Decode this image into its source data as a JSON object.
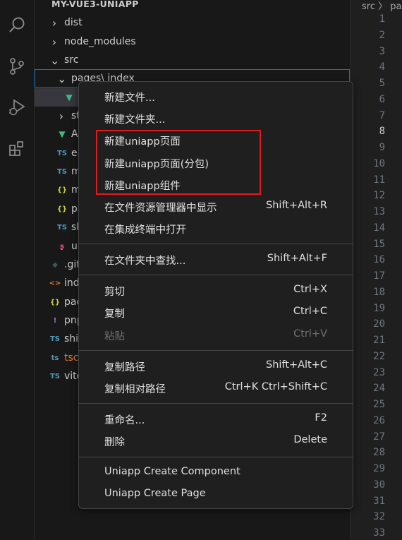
{
  "explorer": {
    "title": "MY-VUE3-UNIAPP",
    "items": [
      {
        "label": "dist",
        "icon": "chevron-right-icon",
        "chev": "›"
      },
      {
        "label": "node_modules",
        "icon": "chevron-right-icon",
        "chev": "›"
      },
      {
        "label": "src",
        "icon": "chevron-down-icon",
        "chev": "⌄"
      },
      {
        "label": "pages\\ index",
        "icon": "chevron-down-icon",
        "chev": "⌄"
      },
      {
        "label": "",
        "icon": "vue-icon",
        "glyph": "▼",
        "color": "#41b883"
      },
      {
        "label": "st",
        "icon": "chevron-right-icon",
        "chev": "›"
      },
      {
        "label": "A",
        "icon": "vue-icon",
        "glyph": "▼",
        "color": "#41b883"
      },
      {
        "label": "er",
        "icon": "typescript-icon",
        "glyph": "TS",
        "color": "#519aba"
      },
      {
        "label": "m",
        "icon": "typescript-icon",
        "glyph": "TS",
        "color": "#519aba"
      },
      {
        "label": "m",
        "icon": "json-icon",
        "glyph": "{}",
        "color": "#cbcb41"
      },
      {
        "label": "pa",
        "icon": "json-icon",
        "glyph": "{}",
        "color": "#cbcb41"
      },
      {
        "label": "sh",
        "icon": "typescript-icon",
        "glyph": "TS",
        "color": "#519aba"
      },
      {
        "label": "ur",
        "icon": "sass-icon",
        "glyph": "ʂ",
        "color": "#f55385"
      },
      {
        "label": ".git",
        "icon": "git-icon",
        "glyph": "◆",
        "color": "#41535b"
      },
      {
        "label": "ind",
        "icon": "html-icon",
        "glyph": "<>",
        "color": "#e37933"
      },
      {
        "label": "pac",
        "icon": "json-icon",
        "glyph": "{}",
        "color": "#cbcb41"
      },
      {
        "label": "pnp",
        "icon": "yaml-icon",
        "glyph": "!",
        "color": "#a074c4"
      },
      {
        "label": "shi",
        "icon": "typescript-icon",
        "glyph": "TS",
        "color": "#519aba"
      },
      {
        "label": "tsc",
        "icon": "tsconfig-icon",
        "glyph": "ts",
        "color": "#519aba",
        "labelColor": "#e37933"
      },
      {
        "label": "vite",
        "icon": "typescript-icon",
        "glyph": "TS",
        "color": "#519aba"
      }
    ]
  },
  "editor": {
    "breadcrumb": "src 〉 pa",
    "line_numbers": [
      "1",
      "2",
      "3",
      "4",
      "5",
      "6",
      "7",
      "8",
      "9",
      "10",
      "11",
      "12",
      "13",
      "14",
      "15",
      "16",
      "17",
      "18",
      "19",
      "20",
      "21",
      "22",
      "23",
      "24",
      "25",
      "26",
      "27",
      "28",
      "29",
      "30",
      "31",
      "32",
      "33"
    ],
    "current_line": "8"
  },
  "context_menu": {
    "groups": [
      [
        {
          "label": "新建文件...",
          "shortcut": ""
        },
        {
          "label": "新建文件夹...",
          "shortcut": ""
        },
        {
          "label": "新建uniapp页面",
          "shortcut": ""
        },
        {
          "label": "新建uniapp页面(分包)",
          "shortcut": ""
        },
        {
          "label": "新建uniapp组件",
          "shortcut": ""
        },
        {
          "label": "在文件资源管理器中显示",
          "shortcut": "Shift+Alt+R"
        },
        {
          "label": "在集成终端中打开",
          "shortcut": ""
        }
      ],
      [
        {
          "label": "在文件夹中查找...",
          "shortcut": "Shift+Alt+F"
        }
      ],
      [
        {
          "label": "剪切",
          "shortcut": "Ctrl+X"
        },
        {
          "label": "复制",
          "shortcut": "Ctrl+C"
        },
        {
          "label": "粘贴",
          "shortcut": "Ctrl+V",
          "disabled": true
        }
      ],
      [
        {
          "label": "复制路径",
          "shortcut": "Shift+Alt+C"
        },
        {
          "label": "复制相对路径",
          "shortcut": "Ctrl+K Ctrl+Shift+C"
        }
      ],
      [
        {
          "label": "重命名...",
          "shortcut": "F2"
        },
        {
          "label": "删除",
          "shortcut": "Delete"
        }
      ],
      [
        {
          "label": "Uniapp Create Component",
          "shortcut": ""
        },
        {
          "label": "Uniapp Create Page",
          "shortcut": ""
        }
      ]
    ]
  },
  "colors": {
    "accent": "#0078d4",
    "highlight_box": "#e01b1b"
  }
}
